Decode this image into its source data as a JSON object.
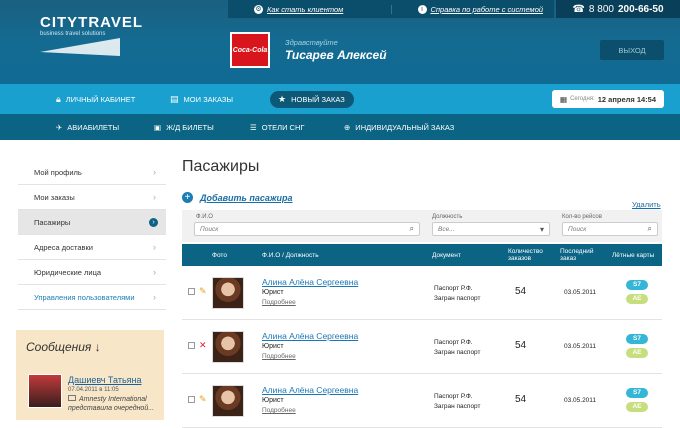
{
  "brand": {
    "name": "CITYTRAVEL",
    "tagline": "business travel solutions"
  },
  "toplinks": [
    {
      "label": "Как стать клиентом",
      "icon": "gear-icon"
    },
    {
      "label": "Справка по работе с системой",
      "icon": "info-icon"
    }
  ],
  "phone": {
    "prefix": "8 800",
    "number": "200-66-50",
    "icon": "phone-icon"
  },
  "company_logo": "Coca-Cola",
  "user": {
    "greeting": "Здравствуйте",
    "name": "Тисарев Алексей"
  },
  "logout_label": "ВЫХОД",
  "nav_primary": [
    {
      "label": "ЛИЧНЫЙ КАБИНЕТ",
      "icon": "lock-icon"
    },
    {
      "label": "МОИ ЗАКАЗЫ",
      "icon": "folder-icon"
    },
    {
      "label": "НОВЫЙ ЗАКАЗ",
      "icon": "star-icon"
    }
  ],
  "date": {
    "label": "Сегодня:",
    "value": "12 апреля 14:54"
  },
  "nav_secondary": [
    {
      "label": "АВИАБИЛЕТЫ",
      "icon": "plane-icon"
    },
    {
      "label": "Ж/Д БИЛЕТЫ",
      "icon": "train-icon"
    },
    {
      "label": "ОТЕЛИ СНГ",
      "icon": "bed-icon"
    },
    {
      "label": "ИНДИВИДУАЛЬНЫЙ ЗАКАЗ",
      "icon": "plus-circle-icon"
    }
  ],
  "sidebar": {
    "items": [
      {
        "label": "Мой профиль"
      },
      {
        "label": "Мои заказы"
      },
      {
        "label": "Пасажиры"
      },
      {
        "label": "Адреса доставки"
      },
      {
        "label": "Юридические лица"
      },
      {
        "label": "Управления пользователями"
      }
    ],
    "selected": "Пасажиры"
  },
  "messages": {
    "title": "Сообщения ↓",
    "items": [
      {
        "author": "Дашиевч Татьяна",
        "date": "07.04.2011 в 11:05",
        "text": "Amnesty International представила очередной..."
      }
    ]
  },
  "page": {
    "title": "Пасажиры",
    "add_label": "Добавить пасажира",
    "delete_label": "Удалить"
  },
  "filters": {
    "name_label": "Ф.И.О",
    "name_placeholder": "Поиск",
    "position_label": "Должность",
    "position_value": "Все...",
    "trips_label": "Кол-во рейсов",
    "trips_placeholder": "Поиск"
  },
  "table": {
    "headers": [
      "Фото",
      "Ф.И.О / Должность",
      "Документ",
      "Количество заказов",
      "Последний заказ",
      "Лётные карты"
    ],
    "rows": [
      {
        "name": "Алина Алёна Сергеевна",
        "role": "Юрист",
        "more": "Подробнее",
        "doc1": "Паспорт Р.Ф.",
        "doc2": "Загран паспорт",
        "orders": "54",
        "last": "03.05.2011",
        "cards": [
          "S7",
          "AE"
        ],
        "action_icon": "pencil-icon"
      },
      {
        "name": "Алина Алёна Сергеевна",
        "role": "Юрист",
        "more": "Подробнее",
        "doc1": "Паспорт Р.Ф.",
        "doc2": "Загран паспорт",
        "orders": "54",
        "last": "03.05.2011",
        "cards": [
          "S7",
          "AE"
        ],
        "action_icon": "delete-x-icon"
      },
      {
        "name": "Алина Алёна Сергеевна",
        "role": "Юрист",
        "more": "Подробнее",
        "doc1": "Паспорт Р.Ф.",
        "doc2": "Загран паспорт",
        "orders": "54",
        "last": "03.05.2011",
        "cards": [
          "S7",
          "AE"
        ],
        "action_icon": "pencil-icon"
      }
    ]
  }
}
